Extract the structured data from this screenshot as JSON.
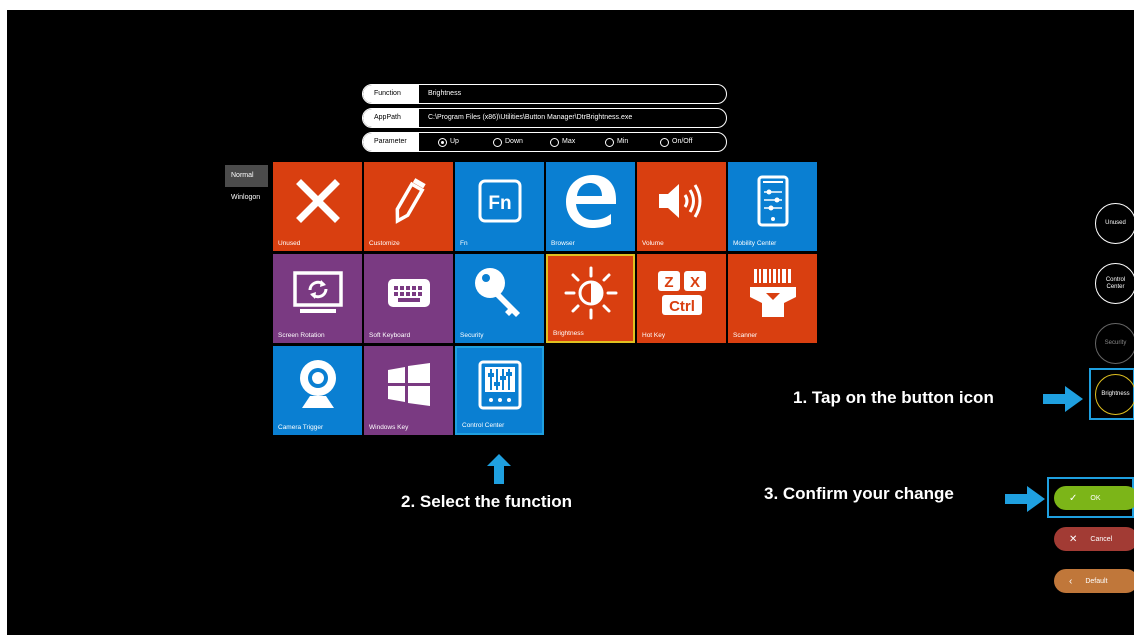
{
  "function_row": {
    "label": "Function",
    "value": "Brightness"
  },
  "apppath_row": {
    "label": "AppPath",
    "value": "C:\\Program Files (x86)\\Utilities\\Button Manager\\DtrBrightness.exe"
  },
  "parameter_row": {
    "label": "Parameter",
    "options": [
      {
        "label": "Up",
        "selected": true
      },
      {
        "label": "Down",
        "selected": false
      },
      {
        "label": "Max",
        "selected": false
      },
      {
        "label": "Min",
        "selected": false
      },
      {
        "label": "On/Off",
        "selected": false
      }
    ]
  },
  "side_menu": [
    {
      "label": "Normal",
      "active": true
    },
    {
      "label": "Winlogon",
      "active": false
    }
  ],
  "tiles": [
    {
      "label": "Unused",
      "icon": "close-x-icon",
      "color": "#d93f10"
    },
    {
      "label": "Customize",
      "icon": "pencil-icon",
      "color": "#d93f10"
    },
    {
      "label": "Fn",
      "icon": "fn-icon",
      "color": "#0a7fd2"
    },
    {
      "label": "Browser",
      "icon": "edge-icon",
      "color": "#0a7fd2"
    },
    {
      "label": "Volume",
      "icon": "speaker-icon",
      "color": "#d93f10"
    },
    {
      "label": "Mobility Center",
      "icon": "mobility-center-icon",
      "color": "#0a7fd2"
    },
    {
      "label": "Screen Rotation",
      "icon": "screen-rotation-icon",
      "color": "#7a3a82"
    },
    {
      "label": "Soft Keyboard",
      "icon": "keyboard-icon",
      "color": "#7a3a82"
    },
    {
      "label": "Security",
      "icon": "key-icon",
      "color": "#0a7fd2"
    },
    {
      "label": "Brightness",
      "icon": "brightness-icon",
      "color": "#d93f10",
      "selected": true
    },
    {
      "label": "Hot Key",
      "icon": "hotkey-icon",
      "color": "#d93f10"
    },
    {
      "label": "Scanner",
      "icon": "scanner-icon",
      "color": "#d93f10"
    },
    {
      "label": "Camera Trigger",
      "icon": "webcam-icon",
      "color": "#0a7fd2"
    },
    {
      "label": "Windows Key",
      "icon": "windows-icon",
      "color": "#7a3a82"
    },
    {
      "label": "Control Center",
      "icon": "control-center-icon",
      "color": "#0a7fd2",
      "highlighted": true
    }
  ],
  "hotkey_text": {
    "z": "Z",
    "x": "X",
    "ctrl": "Ctrl"
  },
  "fn_text": "Fn",
  "buttons": {
    "unused": "Unused",
    "control_center": "Control\nCenter",
    "security": "Security",
    "brightness": "Brightness"
  },
  "actions": {
    "ok": "OK",
    "cancel": "Cancel",
    "default": "Default"
  },
  "annotations": {
    "step1": "1. Tap on the button icon",
    "step2": "2. Select the function",
    "step3": "3. Confirm your change"
  },
  "colors": {
    "orange": "#d93f10",
    "blue": "#0a7fd2",
    "purple": "#7a3a82",
    "highlight_blue": "#1fa0e0",
    "selected_yellow": "#e0c020",
    "ok_green": "#7cb518",
    "cancel_red": "#a23b34",
    "default_tan": "#c0773a"
  }
}
